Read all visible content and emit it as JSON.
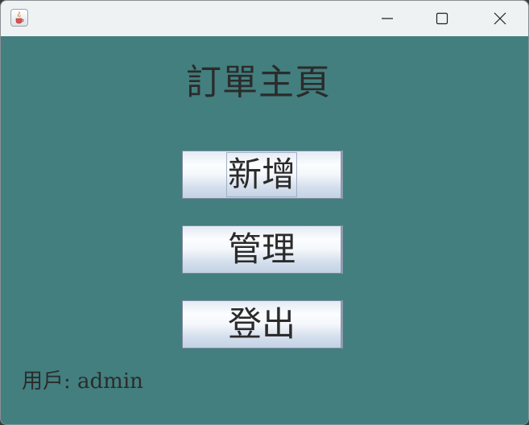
{
  "window": {
    "controls": {
      "minimize_icon": "minimize-icon",
      "maximize_icon": "maximize-icon",
      "close_icon": "close-icon"
    },
    "app_icon": "java-cup-icon",
    "colors": {
      "background": "#437f7f",
      "titlebar": "#eef2f3",
      "text": "#2b2b2b"
    }
  },
  "main": {
    "title": "訂單主頁",
    "buttons": [
      {
        "label": "新增"
      },
      {
        "label": "管理"
      },
      {
        "label": "登出"
      }
    ],
    "user_label": "用戶: admin"
  }
}
